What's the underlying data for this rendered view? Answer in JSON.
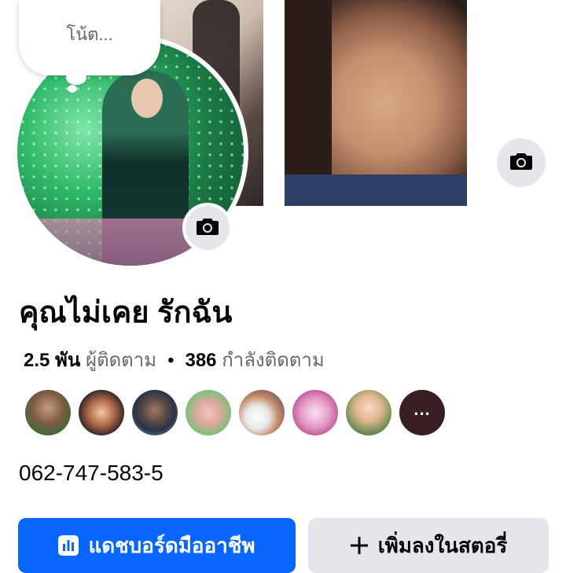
{
  "note": {
    "placeholder": "โน้ต..."
  },
  "profile": {
    "name": "คุณไม่เคย รักฉัน",
    "followers_count": "2.5 พัน",
    "followers_label": "ผู้ติดตาม",
    "separator": "•",
    "following_count": "386",
    "following_label": "กำลังติดตาม",
    "phone": "062-747-583-5"
  },
  "follower_avatars": [
    {
      "icon": "avatar-1"
    },
    {
      "icon": "avatar-2"
    },
    {
      "icon": "avatar-3"
    },
    {
      "icon": "avatar-4"
    },
    {
      "icon": "avatar-5"
    },
    {
      "icon": "avatar-6"
    },
    {
      "icon": "avatar-7"
    }
  ],
  "more_followers": {
    "label": "..."
  },
  "actions": {
    "dashboard_label": "แดชบอร์ดมืออาชีพ",
    "add_story_label": "เพิ่มลงในสตอรี่"
  },
  "icons": {
    "cover_camera": "camera-icon",
    "avatar_camera": "camera-icon",
    "dashboard": "bar-chart-icon",
    "add": "plus-icon"
  },
  "colors": {
    "primary": "#0866ff",
    "secondary_bg": "#e4e6eb",
    "muted_text": "#65676b"
  }
}
